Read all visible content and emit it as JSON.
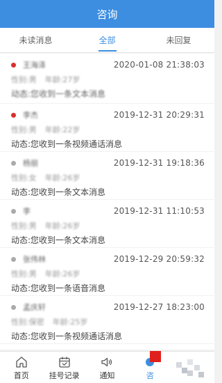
{
  "header": {
    "title": "咨询"
  },
  "tabs": [
    {
      "label": "未读消息",
      "active": false
    },
    {
      "label": "全部",
      "active": true
    },
    {
      "label": "未回复",
      "active": false
    }
  ],
  "messages": [
    {
      "name": "王海泽",
      "time": "2020-01-08 21:38:03",
      "gender": "性别:男",
      "age": "年龄:27岁",
      "text": "动态:您收到一条文本消息",
      "unread": true
    },
    {
      "name": "李杰",
      "time": "2019-12-31 20:29:31",
      "gender": "性别:男",
      "age": "年龄:22岁",
      "text": "动态:您收到一条视频通话消息",
      "unread": true
    },
    {
      "name": "杨丽",
      "time": "2019-12-31 19:18:36",
      "gender": "性别:女",
      "age": "年龄:26岁",
      "text": "动态:您收到一条文本消息",
      "unread": false
    },
    {
      "name": "李",
      "time": "2019-12-31 11:10:53",
      "gender": "性别:男",
      "age": "年龄:26岁",
      "text": "动态:您收到一条文本消息",
      "unread": false
    },
    {
      "name": "张伟林",
      "time": "2019-12-29 20:59:32",
      "gender": "性别:男",
      "age": "年龄:26岁",
      "text": "动态:您收到一条语音消息",
      "unread": false
    },
    {
      "name": "孟庆轩",
      "time": "2019-12-27 18:23:00",
      "gender": "性别:保密",
      "age": "年龄:25岁",
      "text": "动态:您收到一条视频通话消息",
      "unread": false
    }
  ],
  "nav": {
    "home": "首页",
    "records": "挂号记录",
    "notice": "通知",
    "consult": "咨"
  },
  "colors": {
    "accent": "#3d8ee0",
    "unread_dot": "#d9302c",
    "badge": "#e0201c"
  }
}
